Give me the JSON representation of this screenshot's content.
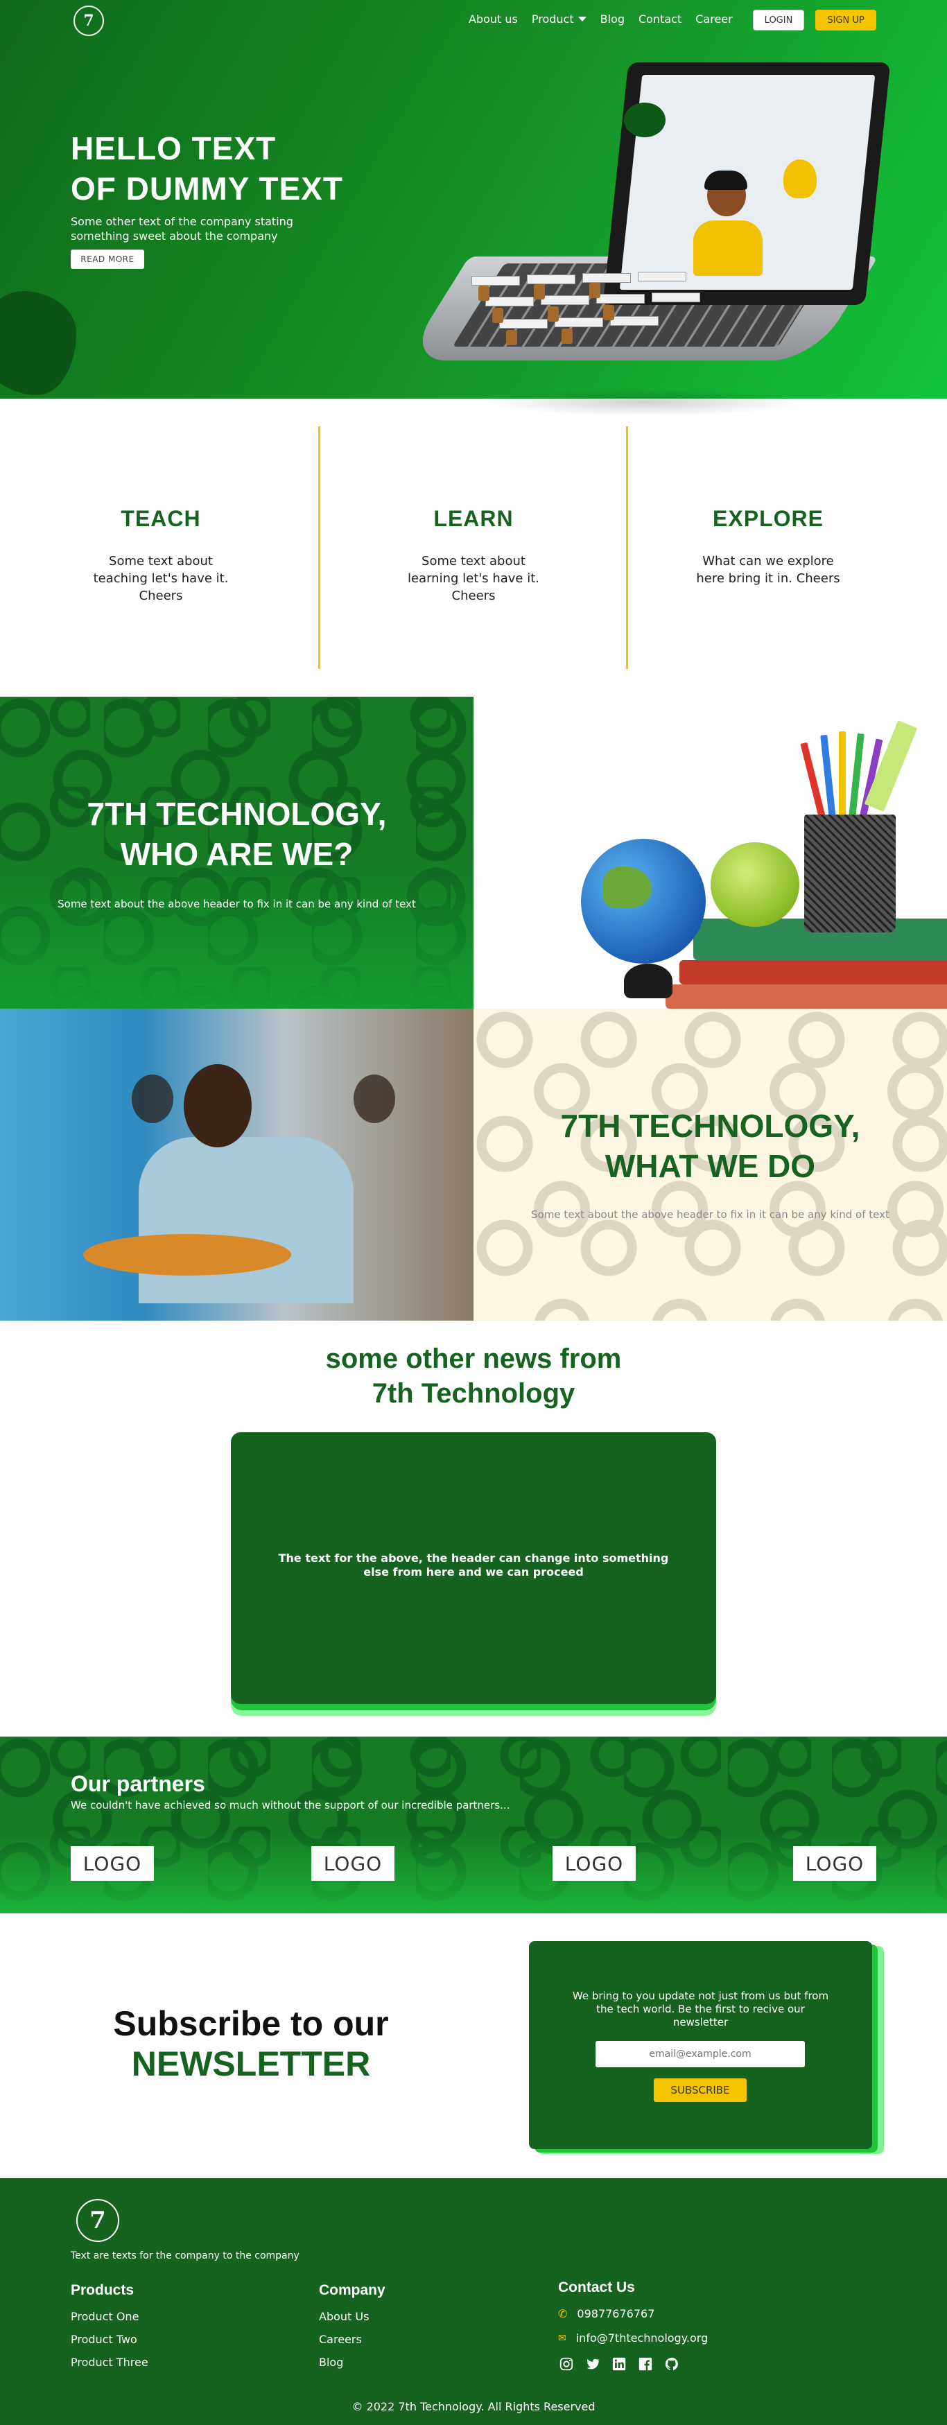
{
  "nav": {
    "logo_glyph": "7",
    "items": [
      "About us",
      "Product",
      "Blog",
      "Contact",
      "Career"
    ],
    "login_label": "LOGIN",
    "signup_label": "SIGN UP"
  },
  "hero": {
    "title_line1": "HELLO TEXT",
    "title_line2": "OF DUMMY TEXT",
    "subtitle": "Some other text of the company stating something sweet about the company",
    "button_label": "READ MORE"
  },
  "features": [
    {
      "title": "TEACH",
      "text": "Some text about teaching let's have it. Cheers"
    },
    {
      "title": "LEARN",
      "text": "Some text about learning let's have it. Cheers"
    },
    {
      "title": "EXPLORE",
      "text": "What can we explore here bring it in. Cheers"
    }
  ],
  "who": {
    "title_line1": "7TH TECHNOLOGY,",
    "title_line2": "WHO ARE WE?",
    "text": "Some text about the above header to fix in it can be any kind of text"
  },
  "what": {
    "title_line1": "7TH TECHNOLOGY,",
    "title_line2": "WHAT WE DO",
    "text": "Some text about the above header to fix in it can be any kind of text"
  },
  "news": {
    "title_line1": "some other news from",
    "title_line2": "7th Technology",
    "card_text": "The text for the above, the header can change into something else from here and we can proceed"
  },
  "partners": {
    "title": "Our partners",
    "text": "We couldn't have achieved so much without the support of our incredible partners...",
    "logos": [
      "LOGO",
      "LOGO",
      "LOGO",
      "LOGO"
    ]
  },
  "newsletter": {
    "title_line1": "Subscribe to our",
    "title_line2": "NEWSLETTER",
    "text": "We bring to you update not just from us but from the tech world. Be the first to recive our newsletter",
    "placeholder": "email@example.com",
    "button_label": "SUBSCRIBE"
  },
  "footer": {
    "logo_glyph": "7",
    "tagline": "Text are texts for the company to the company",
    "products_title": "Products",
    "products": [
      "Product One",
      "Product Two",
      "Product Three"
    ],
    "company_title": "Company",
    "company": [
      "About Us",
      "Careers",
      "Blog"
    ],
    "contact_title": "Contact Us",
    "phone": "09877676767",
    "email": "info@7thtechnology.org",
    "social_icons": [
      "instagram-icon",
      "twitter-icon",
      "linkedin-icon",
      "facebook-icon",
      "github-icon"
    ],
    "copyright": "© 2022 7th Technology. All Rights Reserved"
  },
  "colors": {
    "brand_green": "#16631f",
    "accent_yellow": "#f5c400",
    "bright_green": "#11c53a"
  }
}
